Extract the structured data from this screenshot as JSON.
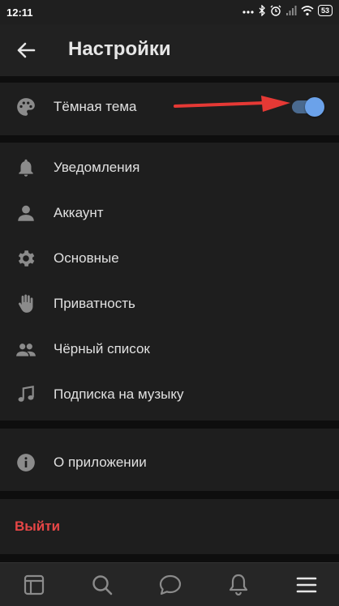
{
  "status_bar": {
    "time": "12:11",
    "battery": "53",
    "icons": [
      "dots-icon",
      "bluetooth-icon",
      "alarm-icon",
      "signal-icon",
      "wifi-icon",
      "battery-icon"
    ]
  },
  "header": {
    "title": "Настройки",
    "back_icon": "arrow-left-icon"
  },
  "dark_theme": {
    "label": "Тёмная тема",
    "icon": "palette-icon",
    "enabled": true,
    "accent_color": "#6ba2ea",
    "annotation_arrow_color": "#e53935"
  },
  "menu": {
    "items": [
      {
        "label": "Уведомления",
        "icon": "bell-icon"
      },
      {
        "label": "Аккаунт",
        "icon": "person-icon"
      },
      {
        "label": "Основные",
        "icon": "gear-icon"
      },
      {
        "label": "Приватность",
        "icon": "hand-icon"
      },
      {
        "label": "Чёрный список",
        "icon": "people-icon"
      },
      {
        "label": "Подписка на музыку",
        "icon": "music-note-icon"
      }
    ]
  },
  "about": {
    "label": "О приложении",
    "icon": "info-icon"
  },
  "logout": {
    "label": "Выйти",
    "color": "#e64646"
  },
  "tab_bar": {
    "tabs": [
      "news-icon",
      "search-icon",
      "messages-icon",
      "notifications-icon",
      "menu-icon"
    ],
    "active": "menu-icon"
  }
}
